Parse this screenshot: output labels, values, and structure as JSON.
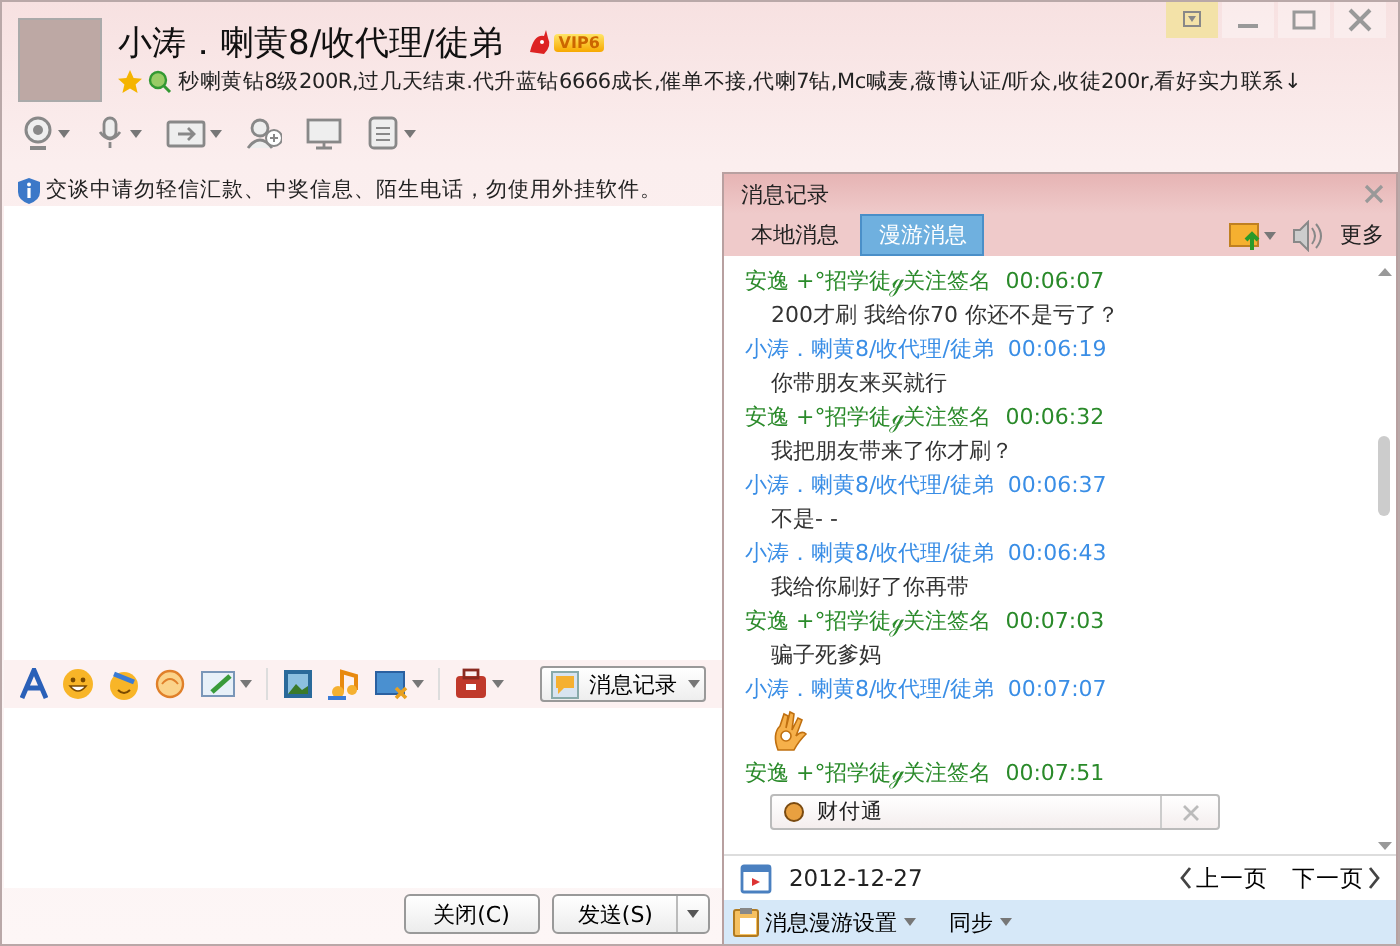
{
  "contact": {
    "name": "小涛．喇黄8/收代理/徒弟",
    "badge": "VIP6",
    "signature": "秒喇黄钻8级200R,过几天结束.代升蓝钻6666成长,催单不接,代喇7钻,Mc喊麦,薇博认证/听众,收徒200r,看好实力联系↓"
  },
  "notice": "交谈中请勿轻信汇款、中奖信息、陌生电话，勿使用外挂软件。",
  "history_button": "消息记录",
  "buttons": [
    "关闭(C)",
    "发送(S)"
  ],
  "history": {
    "title": "消息记录",
    "tabs": [
      {
        "label": "本地消息",
        "selected": false
      },
      {
        "label": "漫游消息",
        "selected": true
      }
    ],
    "more": "更多",
    "messages": [
      {
        "color": "#2a8a2a",
        "sender": "安逸 +°招学徒ℊ关注签名",
        "time": "00:06:07",
        "kind": "text",
        "text": "200才刷 我给你70 你还不是亏了？"
      },
      {
        "color": "#3a8ee6",
        "sender": "小涛．喇黄8/收代理/徒弟",
        "time": "00:06:19",
        "kind": "text",
        "text": "你带朋友来买就行"
      },
      {
        "color": "#2a8a2a",
        "sender": "安逸 +°招学徒ℊ关注签名",
        "time": "00:06:32",
        "kind": "text",
        "text": "我把朋友带来了你才刷？"
      },
      {
        "color": "#3a8ee6",
        "sender": "小涛．喇黄8/收代理/徒弟",
        "time": "00:06:37",
        "kind": "text",
        "text": "不是- -"
      },
      {
        "color": "#3a8ee6",
        "sender": "小涛．喇黄8/收代理/徒弟",
        "time": "00:06:43",
        "kind": "text",
        "text": "我给你刷好了你再带"
      },
      {
        "color": "#2a8a2a",
        "sender": "安逸 +°招学徒ℊ关注签名",
        "time": "00:07:03",
        "kind": "text",
        "text": "骗子死爹妈"
      },
      {
        "color": "#3a8ee6",
        "sender": "小涛．喇黄8/收代理/徒弟",
        "time": "00:07:07",
        "kind": "emoji"
      },
      {
        "color": "#2a8a2a",
        "sender": "安逸 +°招学徒ℊ关注签名",
        "time": "00:07:51",
        "kind": "card",
        "text": "财付通"
      }
    ],
    "date": "2012-12-27",
    "prev": "上一页",
    "next": "下一页",
    "settings": "消息漫游设置",
    "sync": "同步"
  }
}
